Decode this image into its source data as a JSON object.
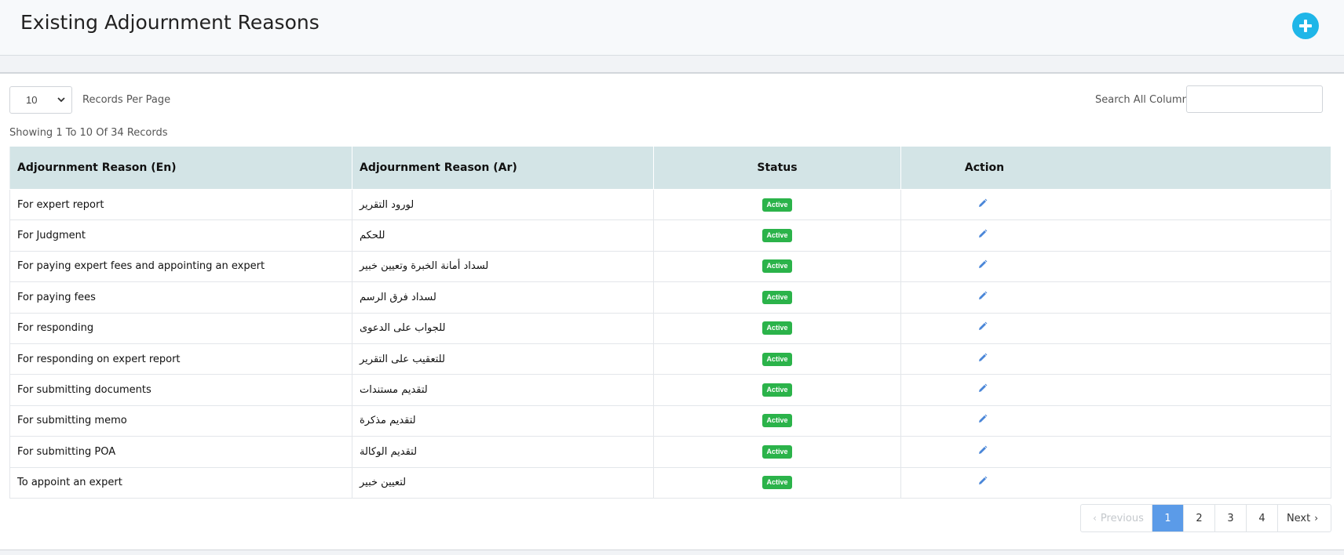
{
  "header": {
    "title": "Existing Adjournment Reasons",
    "add_icon": "plus-circle-icon",
    "accent_color": "#1fb6e8"
  },
  "toolbar": {
    "records_per_page_value": "10",
    "records_per_page_label": "Records Per Page",
    "search_label": "Search All Columns",
    "search_value": ""
  },
  "summary": {
    "showing_text": "Showing 1 To 10 Of 34 Records"
  },
  "table": {
    "columns": [
      "Adjournment Reason (En)",
      "Adjournment Reason (Ar)",
      "Status",
      "Action"
    ],
    "rows": [
      {
        "en": "For expert report",
        "ar": "لورود التقرير",
        "status": "Active"
      },
      {
        "en": "For Judgment",
        "ar": "للحكم",
        "status": "Active"
      },
      {
        "en": "For paying expert fees and appointing an expert",
        "ar": "لسداد أمانة الخبرة وتعيين خبير",
        "status": "Active"
      },
      {
        "en": "For paying fees",
        "ar": "لسداد فرق الرسم",
        "status": "Active"
      },
      {
        "en": "For responding",
        "ar": "للجواب على الدعوى",
        "status": "Active"
      },
      {
        "en": "For responding on expert report",
        "ar": "للتعقيب على التقرير",
        "status": "Active"
      },
      {
        "en": "For submitting documents",
        "ar": "لتقديم مستندات",
        "status": "Active"
      },
      {
        "en": "For submitting memo",
        "ar": "لتقديم مذكرة",
        "status": "Active"
      },
      {
        "en": "For submitting POA",
        "ar": "لتقديم الوكالة",
        "status": "Active"
      },
      {
        "en": "To appoint an expert",
        "ar": "لتعيين خبير",
        "status": "Active"
      }
    ],
    "action_icon": "pencil-icon",
    "status_color": "#2bb34a",
    "header_bg": "#d3e4e6"
  },
  "pagination": {
    "previous_label": "Previous",
    "next_label": "Next",
    "pages": [
      "1",
      "2",
      "3",
      "4"
    ],
    "current_page": "1",
    "active_color": "#5b9be8"
  }
}
